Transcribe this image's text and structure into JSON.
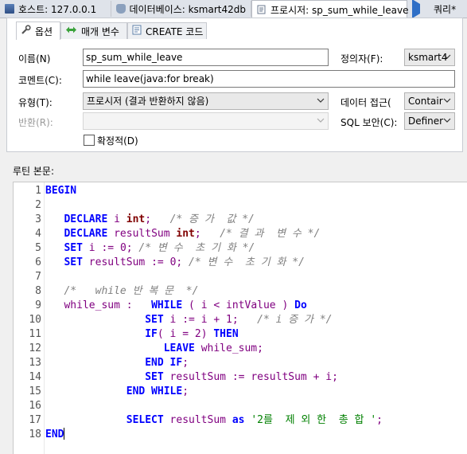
{
  "doc_tabs": [
    {
      "label": "호스트: 127.0.0.1",
      "icon": "host-icon"
    },
    {
      "label": "데이터베이스: ksmart42db",
      "icon": "database-icon"
    },
    {
      "label": "프로시저: sp_sum_while_leave",
      "icon": "procedure-icon"
    },
    {
      "label": "쿼리*",
      "icon": "play-icon"
    }
  ],
  "sub_tabs": [
    {
      "label": "옵션",
      "icon": "wrench-icon"
    },
    {
      "label": "매개 변수",
      "icon": "arrows-icon"
    },
    {
      "label": "CREATE 코드",
      "icon": "code-page-icon"
    }
  ],
  "form": {
    "name_label": "이름(N)",
    "name_value": "sp_sum_while_leave",
    "definer_label": "정의자(F):",
    "definer_value": "ksmart4",
    "comment_label": "코멘트(C):",
    "comment_value": "while leave(java:for break)",
    "type_label": "유형(T):",
    "type_value": "프로시저 (결과 반환하지 않음)",
    "data_access_label": "데이터 접근(",
    "data_access_value": "Contair",
    "returns_label": "반환(R):",
    "returns_value": "",
    "sql_security_label": "SQL 보안(C):",
    "sql_security_value": "Definer",
    "deterministic_label": "확정적(D)",
    "deterministic_checked": false
  },
  "routine_body_label": "루틴 본문:",
  "editor": {
    "line_numbers": [
      "1",
      "2",
      "3",
      "4",
      "5",
      "6",
      "7",
      "8",
      "9",
      "10",
      "11",
      "12",
      "13",
      "14",
      "15",
      "16",
      "17",
      "18"
    ]
  },
  "colors": {
    "keyword": "#0000ff",
    "type": "#800000",
    "identifier": "#800080",
    "comment": "#808080",
    "string": "#008000"
  }
}
